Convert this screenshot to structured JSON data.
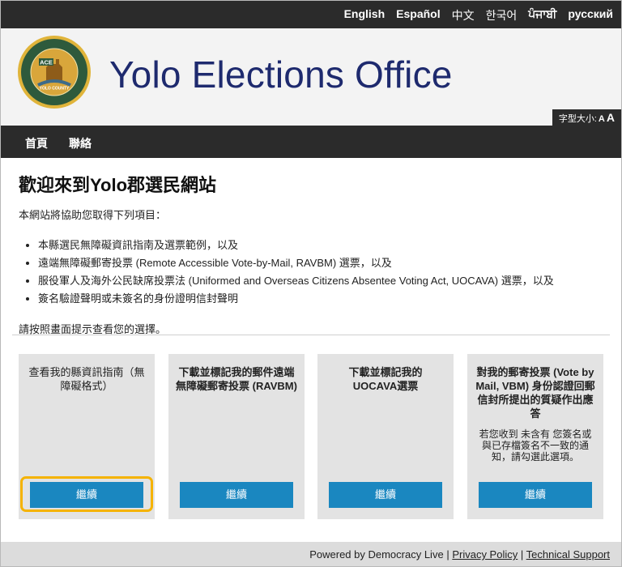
{
  "languages": [
    "English",
    "Español",
    "中文",
    "한국어",
    "ਪੰਜਾਬੀ",
    "русский"
  ],
  "site_title": "Yolo Elections Office",
  "seal": {
    "center_text": "ACE",
    "ring_top": "ASSESSOR | CLERK-RECORDER | ELECTIONS",
    "ring_bottom": "EXCELLENCE WITH INTEGRITY",
    "banner": "YOLO COUNTY"
  },
  "font_size": {
    "label": "字型大小:",
    "small": "A",
    "large": "A"
  },
  "nav": {
    "home": "首頁",
    "contact": "聯絡"
  },
  "main": {
    "heading": "歡迎來到Yolo郡選民網站",
    "intro": "本網站將協助您取得下列項目：",
    "items": [
      "本縣選民無障礙資訊指南及選票範例，以及",
      "遠端無障礙郵寄投票 (Remote Accessible Vote-by-Mail, RAVBM) 選票，以及",
      "服役軍人及海外公民缺席投票法 (Uniformed and Overseas Citizens Absentee Voting Act, UOCAVA) 選票，以及",
      "簽名驗證聲明或未簽名的身份證明信封聲明"
    ],
    "prompt": "請按照畫面提示查看您的選擇。"
  },
  "cards": [
    {
      "title": "查看我的縣資訊指南（無障礙格式）",
      "button": "繼續"
    },
    {
      "title": "下載並標記我的郵件遠端無障礙郵寄投票 (RAVBM)",
      "button": "繼續"
    },
    {
      "title": "下載並標記我的 UOCAVA選票",
      "button": "繼續"
    },
    {
      "title": "對我的郵寄投票 (Vote by Mail, VBM) 身份認證回郵信封所提出的質疑作出應答",
      "note": "若您收到 未含有 您簽名或與已存檔簽名不一致的通知，請勾選此選項。",
      "button": "繼續"
    }
  ],
  "footer": {
    "powered_by": "Powered by Democracy Live",
    "sep": "|",
    "privacy": "Privacy Policy",
    "support": "Technical Support"
  },
  "colors": {
    "dark_bar": "#2b2b2b",
    "title_blue": "#1e2a6e",
    "button_blue": "#1a87c0",
    "highlight": "#f5b300"
  }
}
